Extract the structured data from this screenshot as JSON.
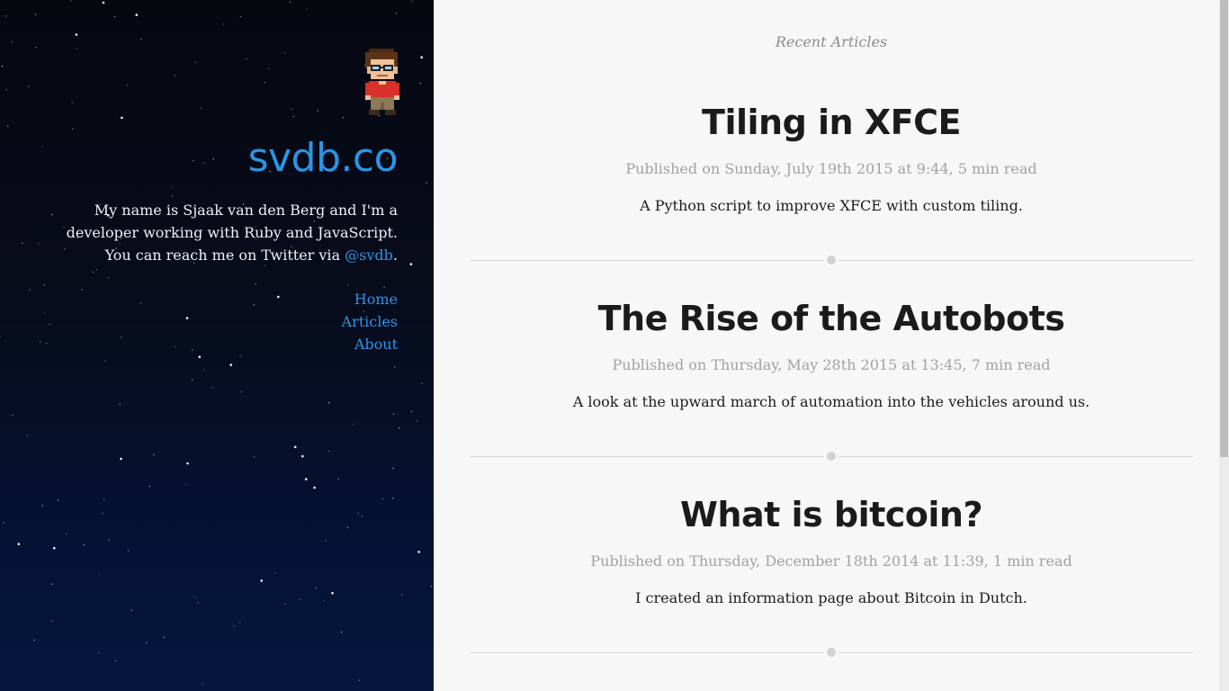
{
  "sidebar": {
    "brand": "svdb.co",
    "bio_text": "My name is Sjaak van den Berg and I'm a developer working with Ruby and JavaScript. You can reach me on Twitter via ",
    "twitter_handle": "@svdb",
    "bio_end": ".",
    "nav": [
      "Home",
      "Articles",
      "About"
    ]
  },
  "main": {
    "section_label": "Recent Articles",
    "articles": [
      {
        "title": "Tiling in XFCE",
        "meta": "Published on Sunday, July 19th 2015 at 9:44, 5 min read",
        "description": "A Python script to improve XFCE with custom tiling."
      },
      {
        "title": "The Rise of the Autobots",
        "meta": "Published on Thursday, May 28th 2015 at 13:45, 7 min read",
        "description": "A look at the upward march of automation into the vehicles around us."
      },
      {
        "title": "What is bitcoin?",
        "meta": "Published on Thursday, December 18th 2014 at 11:39, 1 min read",
        "description": "I created an information page about Bitcoin in Dutch."
      }
    ]
  },
  "colors": {
    "link": "#2a95e6",
    "sidebar_top": "#060810",
    "sidebar_bottom": "#03173f",
    "main_bg": "#f7f7f7"
  },
  "icons": {
    "avatar": "pixel-avatar-icon",
    "divider": "dot-divider-icon"
  }
}
